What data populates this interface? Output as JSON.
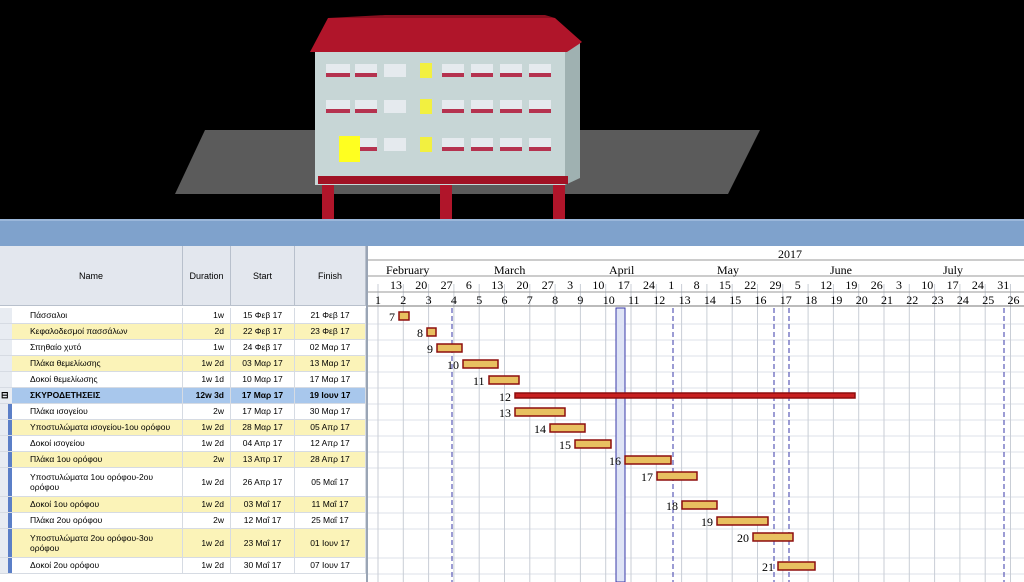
{
  "table": {
    "headers": {
      "name": "Name",
      "duration": "Duration",
      "start": "Start",
      "finish": "Finish"
    },
    "rows": [
      {
        "name": "Πάσσαλοι",
        "duration": "1w",
        "start": "15 Φεβ 17",
        "finish": "21 Φεβ 17",
        "style": "plain"
      },
      {
        "name": "Κεφαλοδεσμοί πασσάλων",
        "duration": "2d",
        "start": "22 Φεβ 17",
        "finish": "23 Φεβ 17",
        "style": "yellow"
      },
      {
        "name": "Σπηθαίο χυτό",
        "duration": "1w",
        "start": "24 Φεβ 17",
        "finish": "02 Μαρ 17",
        "style": "plain"
      },
      {
        "name": "Πλάκα θεμελίωσης",
        "duration": "1w 2d",
        "start": "03 Μαρ 17",
        "finish": "13 Μαρ 17",
        "style": "yellow"
      },
      {
        "name": "Δοκοί θεμελίωσης",
        "duration": "1w 1d",
        "start": "10 Μαρ 17",
        "finish": "17 Μαρ 17",
        "style": "plain"
      },
      {
        "name": "ΣΚΥΡΟΔΕΤΗΣΕΙΣ",
        "duration": "12w 3d",
        "start": "17 Μαρ 17",
        "finish": "19 Ιουν 17",
        "style": "summary"
      },
      {
        "name": "Πλάκα ισογείου",
        "duration": "2w",
        "start": "17 Μαρ 17",
        "finish": "30 Μαρ 17",
        "style": "plain"
      },
      {
        "name": "Υποστυλώματα ισογείου-1ου ορόφου",
        "duration": "1w 2d",
        "start": "28 Μαρ 17",
        "finish": "05 Απρ 17",
        "style": "yellow"
      },
      {
        "name": "Δοκοί ισογείου",
        "duration": "1w 2d",
        "start": "04 Απρ 17",
        "finish": "12 Απρ 17",
        "style": "plain"
      },
      {
        "name": "Πλάκα 1ου ορόφου",
        "duration": "2w",
        "start": "13 Απρ 17",
        "finish": "28 Απρ 17",
        "style": "yellow"
      },
      {
        "name": "Υποστυλώματα 1ου ορόφου-2ου ορόφου",
        "duration": "1w 2d",
        "start": "26 Απρ 17",
        "finish": "05 Μαΐ 17",
        "style": "plain"
      },
      {
        "name": "Δοκοί 1ου ορόφου",
        "duration": "1w 2d",
        "start": "03 Μαΐ 17",
        "finish": "11 Μαΐ 17",
        "style": "yellow"
      },
      {
        "name": "Πλάκα 2ου ορόφου",
        "duration": "2w",
        "start": "12 Μαΐ 17",
        "finish": "25 Μαΐ 17",
        "style": "plain"
      },
      {
        "name": "Υποστυλώματα 2ου ορόφου-3ου ορόφου",
        "duration": "1w 2d",
        "start": "23 Μαΐ 17",
        "finish": "01 Ιουν 17",
        "style": "yellow"
      },
      {
        "name": "Δοκοί 2ου ορόφου",
        "duration": "1w 2d",
        "start": "30 Μαΐ 17",
        "finish": "07 Ιουν 17",
        "style": "plain"
      }
    ]
  },
  "gantt": {
    "year": "2017",
    "months": [
      "February",
      "March",
      "April",
      "May",
      "June",
      "July"
    ],
    "week_days": [
      "13",
      "20",
      "27",
      "6",
      "13",
      "20",
      "27",
      "3",
      "10",
      "17",
      "24",
      "1",
      "8",
      "15",
      "22",
      "29",
      "5",
      "12",
      "19",
      "26",
      "3",
      "10",
      "17",
      "24",
      "31"
    ],
    "period_numbers": [
      "1",
      "2",
      "3",
      "4",
      "5",
      "6",
      "7",
      "8",
      "9",
      "10",
      "11",
      "12",
      "13",
      "14",
      "15",
      "16",
      "17",
      "18",
      "19",
      "20",
      "21",
      "22",
      "23",
      "24",
      "25",
      "26"
    ],
    "bar_ids": [
      "7",
      "8",
      "9",
      "10",
      "11",
      "12",
      "13",
      "14",
      "15",
      "16",
      "17",
      "18",
      "19",
      "20",
      "21"
    ]
  }
}
